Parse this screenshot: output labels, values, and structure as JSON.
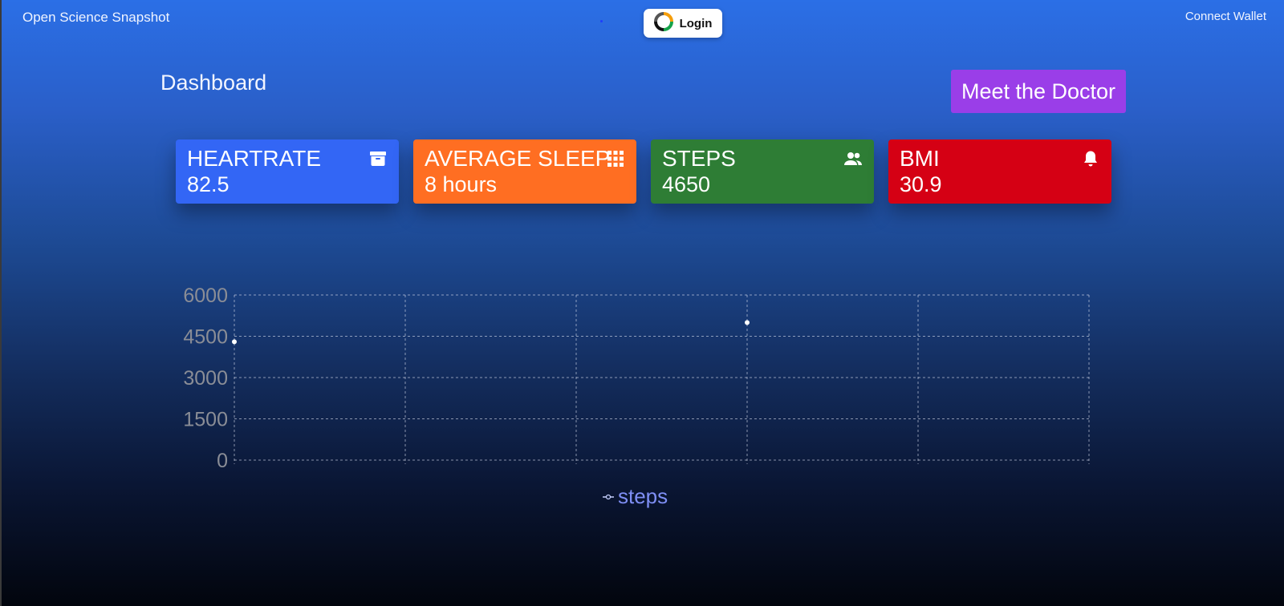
{
  "header": {
    "brand": "Open Science Snapshot",
    "login_label": "Login",
    "wallet_label": "Connect Wallet"
  },
  "page": {
    "title": "Dashboard",
    "doctor_button": "Meet the Doctor"
  },
  "cards": [
    {
      "title": "HEARTRATE",
      "value": "82.5",
      "icon": "archive-icon",
      "color": "#3366f5"
    },
    {
      "title": "AVERAGE SLEEP",
      "value": "8 hours",
      "icon": "grid-icon",
      "color": "#ff6e22"
    },
    {
      "title": "STEPS",
      "value": "4650",
      "icon": "users-icon",
      "color": "#2e7d35"
    },
    {
      "title": "BMI",
      "value": "30.9",
      "icon": "bell-icon",
      "color": "#d50014"
    }
  ],
  "chart_data": {
    "type": "line",
    "series": [
      {
        "name": "steps",
        "points": [
          {
            "x": 0,
            "y": 4300
          },
          {
            "x": 3,
            "y": 5000
          }
        ]
      }
    ],
    "x_categories": 6,
    "ylim": [
      0,
      6000
    ],
    "yticks": [
      "0",
      "1500",
      "3000",
      "4500",
      "6000"
    ],
    "grid": true,
    "legend": "bottom"
  }
}
